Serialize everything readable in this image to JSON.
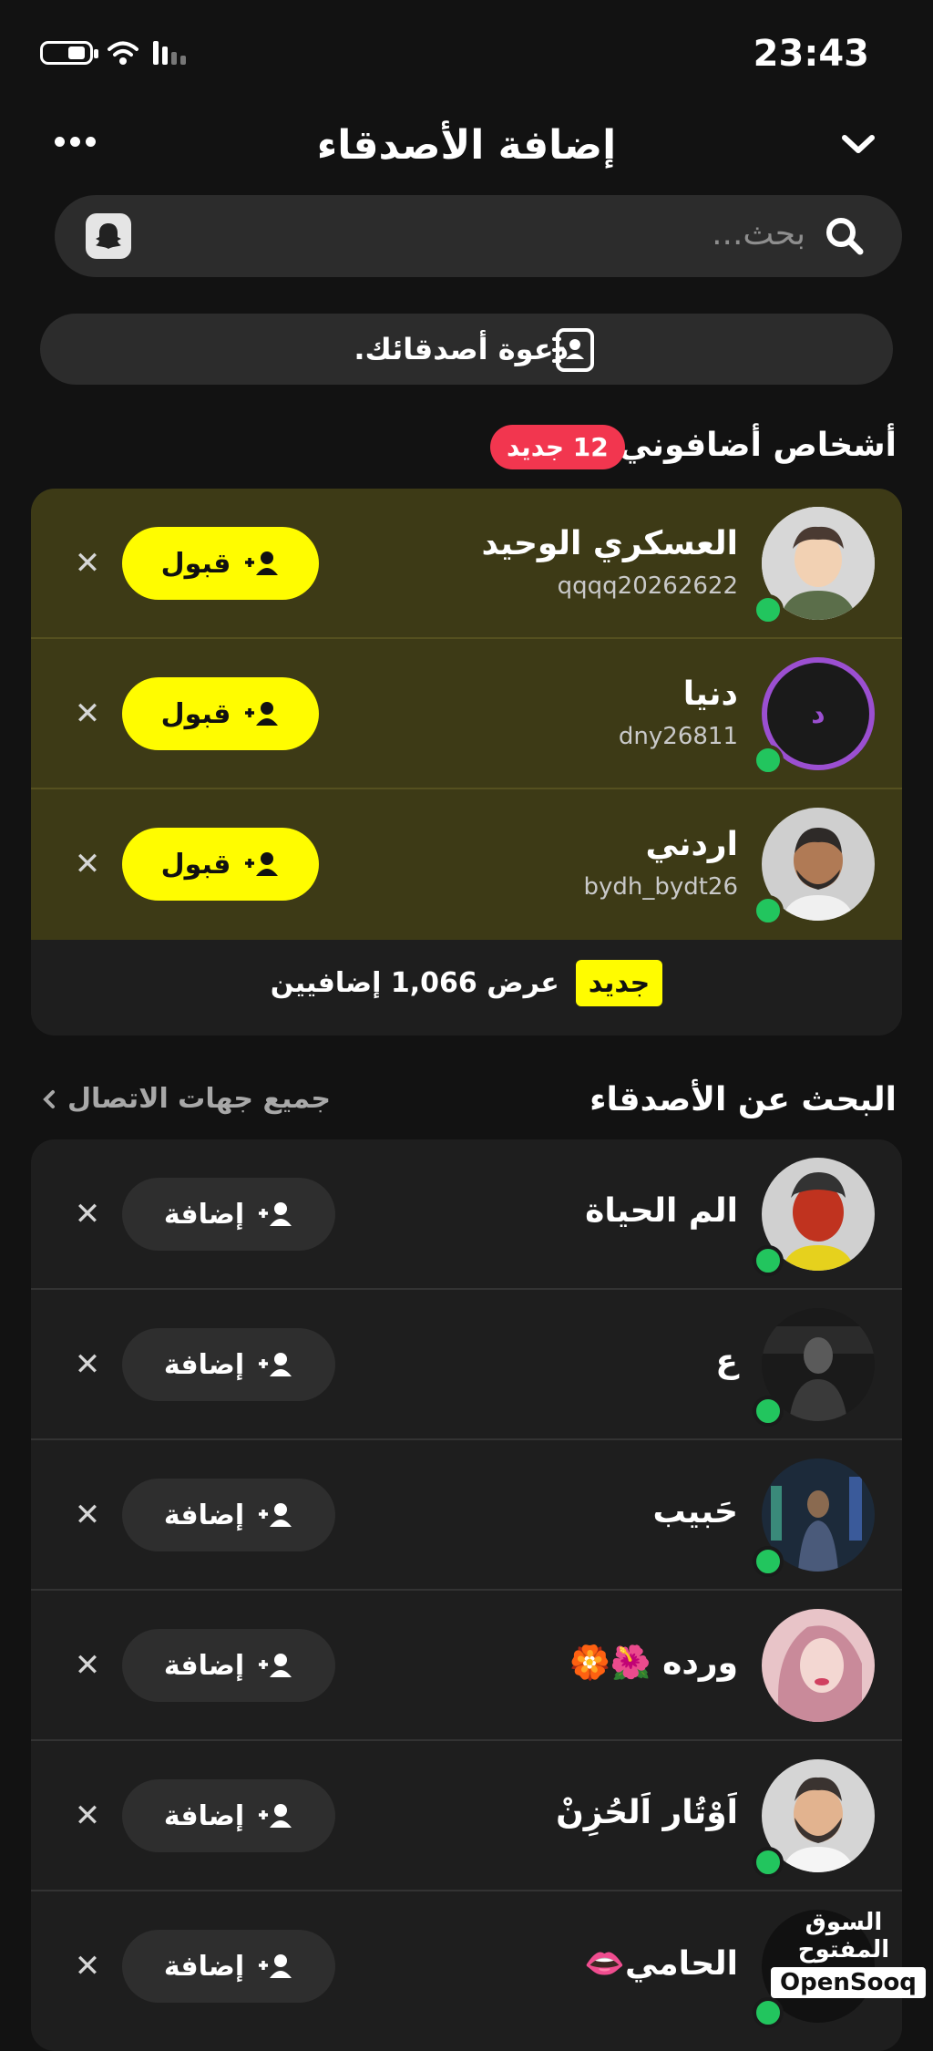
{
  "status_bar": {
    "time": "23:43"
  },
  "header": {
    "title": "إضافة الأصدقاء"
  },
  "search": {
    "placeholder": "بحث..."
  },
  "invite": {
    "label": "دعوة أصدقائك."
  },
  "requests": {
    "title": "أشخاص أضافوني",
    "badge": "12 جديد",
    "accept_label": "قبول",
    "items": [
      {
        "name": "العسكري الوحيد",
        "username": "qqqq20262622"
      },
      {
        "name": "دنيا",
        "username": "dny26811",
        "initial": "د"
      },
      {
        "name": "اردني",
        "username": "bydh_bydt26"
      }
    ],
    "new_tag": "جديد",
    "view_more": "عرض 1,066 إضافيين"
  },
  "find_friends": {
    "title": "البحث عن الأصدقاء",
    "all_contacts": "جميع جهات الاتصال",
    "add_label": "إضافة",
    "items": [
      {
        "name": "الم الحياة"
      },
      {
        "name": "ع"
      },
      {
        "name": "حَبيب"
      },
      {
        "name": "ورده 🌺🏵️"
      },
      {
        "name": "اَوْتُار اَلحُزِنْ"
      },
      {
        "name": "الحامي👄"
      }
    ]
  },
  "watermark": {
    "arabic": "السوق المفتوح",
    "english": "OpenSooq"
  },
  "colors": {
    "accent": "#fffc00",
    "badge": "#f2364f",
    "online": "#22c55e",
    "request_bg": "#3d3a16"
  }
}
